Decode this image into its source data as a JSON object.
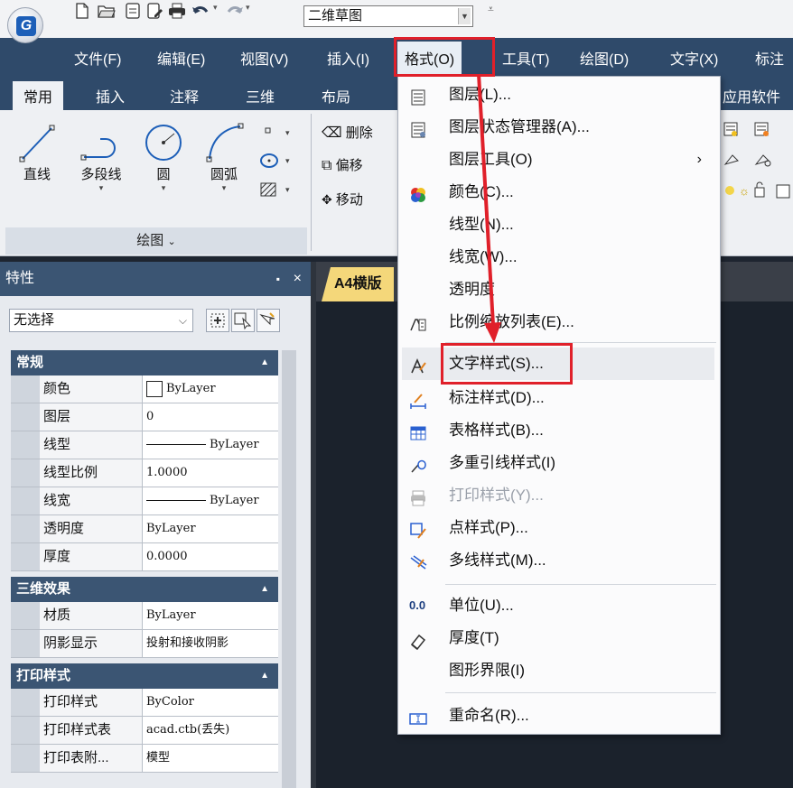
{
  "quick_access": {
    "workspace_value": "二维草图",
    "icons": [
      "new-icon",
      "open-icon",
      "save-icon",
      "saveas-icon",
      "print-icon",
      "undo-icon",
      "redo-icon"
    ]
  },
  "menubar": {
    "items": [
      "文件(F)",
      "编辑(E)",
      "视图(V)",
      "插入(I)",
      "格式(O)",
      "工具(T)",
      "绘图(D)",
      "文字(X)",
      "标注"
    ]
  },
  "ribbon_tabs": [
    "常用",
    "插入",
    "注释",
    "三维",
    "布局",
    "应用软件"
  ],
  "draw_panel": {
    "tools": [
      "直线",
      "多段线",
      "圆",
      "圆弧"
    ],
    "footer": "绘图"
  },
  "modify_panel": {
    "tools": [
      "删除",
      "偏移",
      "移动"
    ]
  },
  "properties": {
    "title": "特性",
    "pin": "ꟷ",
    "close": "×",
    "selection": "无选择",
    "categories": [
      {
        "name": "常规",
        "rows": [
          {
            "k": "颜色",
            "v": "ByLayer"
          },
          {
            "k": "图层",
            "v": "0"
          },
          {
            "k": "线型",
            "v": "ByLayer"
          },
          {
            "k": "线型比例",
            "v": "1.0000"
          },
          {
            "k": "线宽",
            "v": "ByLayer"
          },
          {
            "k": "透明度",
            "v": "ByLayer"
          },
          {
            "k": "厚度",
            "v": "0.0000"
          }
        ]
      },
      {
        "name": "三维效果",
        "rows": [
          {
            "k": "材质",
            "v": "ByLayer"
          },
          {
            "k": "阴影显示",
            "v": "投射和接收阴影"
          }
        ]
      },
      {
        "name": "打印样式",
        "rows": [
          {
            "k": "打印样式",
            "v": "ByColor"
          },
          {
            "k": "打印样式表",
            "v": "acad.ctb(丢失)"
          },
          {
            "k": "打印表附...",
            "v": "模型"
          }
        ]
      }
    ]
  },
  "document_tab": "A4横版",
  "format_menu": {
    "items": [
      {
        "label": "图层(L)...",
        "icon": "layer-icon"
      },
      {
        "label": "图层状态管理器(A)...",
        "icon": "layer-state-icon"
      },
      {
        "label": "图层工具(O)",
        "icon": "",
        "submenu": "›"
      },
      {
        "label": "颜色(C)...",
        "icon": "color-wheel-icon"
      },
      {
        "label": "线型(N)...",
        "icon": ""
      },
      {
        "label": "线宽(W)...",
        "icon": ""
      },
      {
        "label": "透明度",
        "icon": ""
      },
      {
        "label": "比例缩放列表(E)...",
        "icon": "scale-list-icon"
      },
      {
        "label": "文字样式(S)...",
        "icon": "text-style-icon"
      },
      {
        "label": "标注样式(D)...",
        "icon": "dim-style-icon"
      },
      {
        "label": "表格样式(B)...",
        "icon": "table-style-icon"
      },
      {
        "label": "多重引线样式(I)",
        "icon": "mleader-style-icon"
      },
      {
        "label": "打印样式(Y)...",
        "icon": "plot-style-icon",
        "disabled": true
      },
      {
        "label": "点样式(P)...",
        "icon": "point-style-icon"
      },
      {
        "label": "多线样式(M)...",
        "icon": "mline-style-icon"
      },
      {
        "label": "单位(U)...",
        "icon": "units-icon",
        "icon_text": "0.0"
      },
      {
        "label": "厚度(T)",
        "icon": "thickness-icon"
      },
      {
        "label": "图形界限(I)",
        "icon": ""
      },
      {
        "label": "重命名(R)...",
        "icon": "rename-icon"
      }
    ]
  },
  "colors": {
    "menubar": "#2f4a6a",
    "highlight_red": "#e0202a",
    "doc_tab": "#f4d77a",
    "canvas": "#1b222c"
  }
}
